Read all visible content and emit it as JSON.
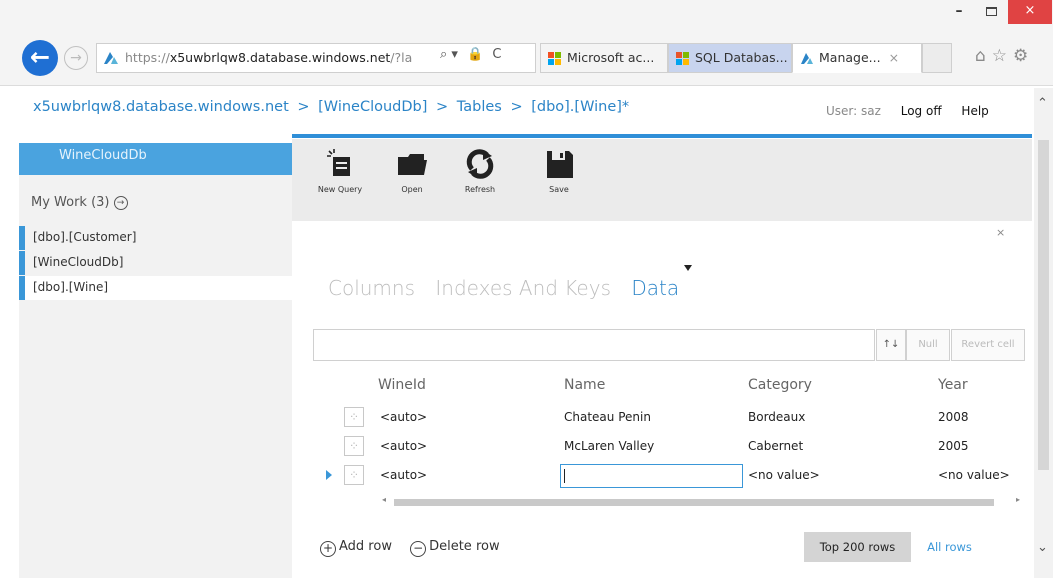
{
  "window": {
    "minimize": "–",
    "close": "×"
  },
  "browser": {
    "back_glyph": "←",
    "forward_glyph": "→",
    "url_prefix": "https://",
    "url_host": "x5uwbrlqw8.database.windows.net",
    "url_suffix": "/?la",
    "address_tools": [
      "⌕ ▾",
      "🔒",
      "C"
    ],
    "tabs": [
      {
        "label": "Microsoft ac...",
        "icon": "microsoft-logo-icon",
        "color": "#f25022"
      },
      {
        "label": "SQL Databas...",
        "icon": "windows-logo-icon",
        "color": "#0078d7"
      },
      {
        "label": "Manage...",
        "icon": "azure-icon",
        "color": "#2b84c7",
        "close": "×"
      }
    ],
    "right_icons": [
      "⌂",
      "☆",
      "⚙"
    ]
  },
  "header": {
    "breadcrumb": [
      "x5uwbrlqw8.database.windows.net",
      "[WineCloudDb]",
      "Tables",
      "[dbo].[Wine]*"
    ],
    "separator": ">",
    "user_label": "User: saz",
    "logoff": "Log off",
    "help": "Help"
  },
  "sidebar": {
    "title": "WineCloudDb",
    "my_work": "My Work (3)",
    "my_work_glyph": "→",
    "items": [
      "[dbo].[Customer]",
      "[WineCloudDb]",
      "[dbo].[Wine]"
    ]
  },
  "toolbar": {
    "new_query": "New Query",
    "open": "Open",
    "refresh": "Refresh",
    "save": "Save",
    "close": "×"
  },
  "tabs": {
    "columns": "Columns",
    "indexes": "Indexes And Keys",
    "data": "Data"
  },
  "filter": {
    "sort": "↑↓",
    "null": "Null",
    "revert": "Revert cell"
  },
  "grid": {
    "columns": [
      "WineId",
      "Name",
      "Category",
      "Year"
    ],
    "rows": [
      {
        "id": "<auto>",
        "name": "Chateau Penin",
        "category": "Bordeaux",
        "year": "2008"
      },
      {
        "id": "<auto>",
        "name": "McLaren Valley",
        "category": "Cabernet",
        "year": "2005"
      },
      {
        "id": "<auto>",
        "name": "",
        "category": "<no value>",
        "year": "<no value>"
      }
    ],
    "row_icon": "⁘"
  },
  "footer": {
    "add_row": "Add row",
    "add_glyph": "+",
    "delete_row": "Delete row",
    "delete_glyph": "−",
    "top_rows": "Top 200 rows",
    "all_rows": "All rows"
  },
  "scroll": {
    "up": "⌃",
    "down": "⌄",
    "left": "◂",
    "right": "▸"
  }
}
